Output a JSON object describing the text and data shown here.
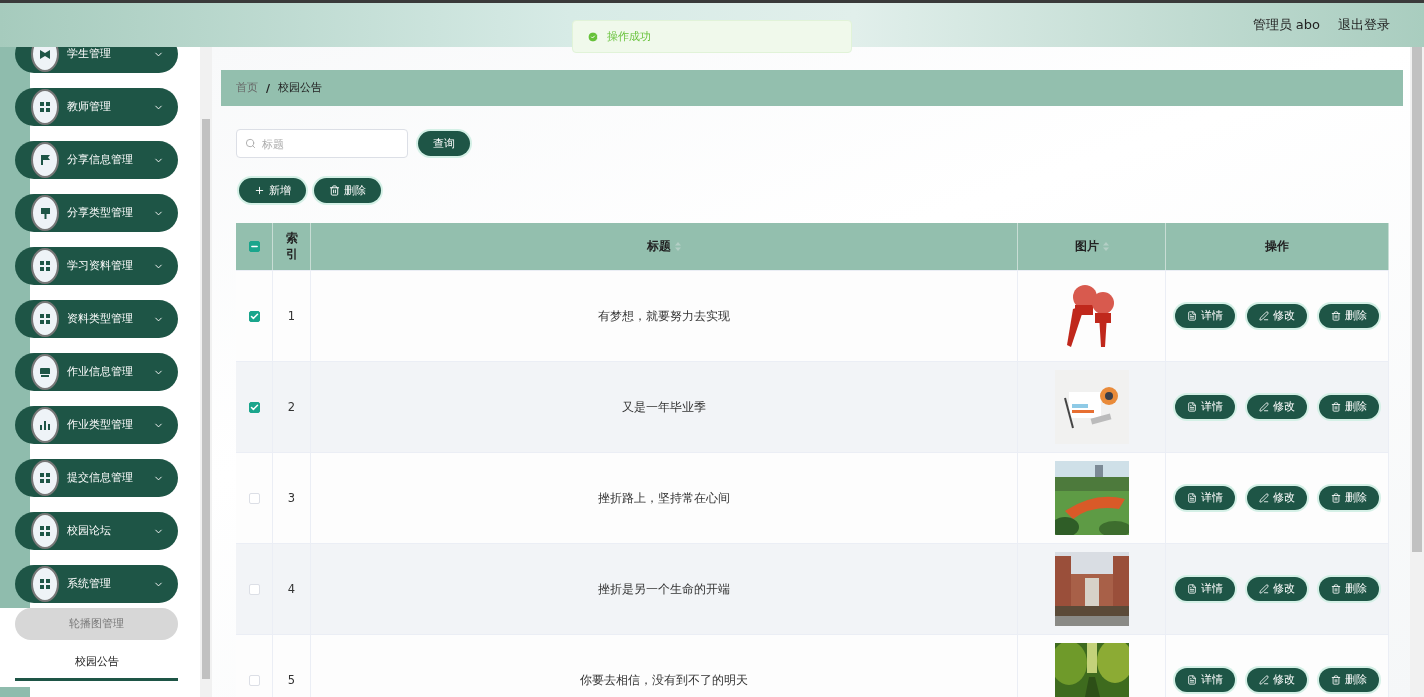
{
  "toast": {
    "message": "操作成功"
  },
  "header": {
    "user": "管理员 abo",
    "logout": "退出登录"
  },
  "sidebar": {
    "items": [
      {
        "label": "学生管理",
        "kind": "bowtie"
      },
      {
        "label": "教师管理",
        "kind": "grid"
      },
      {
        "label": "分享信息管理",
        "kind": "flag"
      },
      {
        "label": "分享类型管理",
        "kind": "pin"
      },
      {
        "label": "学习资料管理",
        "kind": "grid"
      },
      {
        "label": "资料类型管理",
        "kind": "grid"
      },
      {
        "label": "作业信息管理",
        "kind": "monitor"
      },
      {
        "label": "作业类型管理",
        "kind": "chart"
      },
      {
        "label": "提交信息管理",
        "kind": "grid"
      },
      {
        "label": "校园论坛",
        "kind": "grid"
      },
      {
        "label": "系统管理",
        "kind": "grid",
        "children": [
          {
            "label": "轮播图管理",
            "selected": false
          },
          {
            "label": "校园公告",
            "selected": true
          }
        ]
      }
    ]
  },
  "breadcrumb": [
    {
      "label": "首页",
      "selected": false
    },
    {
      "label": "校园公告",
      "selected": true
    }
  ],
  "breadcrumb_separator": "/",
  "search": {
    "placeholder": "标题",
    "button": "查询"
  },
  "toolbar": [
    {
      "label": "新增",
      "kind": "add"
    },
    {
      "label": "删除",
      "kind": "delete"
    }
  ],
  "table": {
    "select_all": {
      "indeterminate": true
    },
    "columns": [
      {
        "label": "索引",
        "sortable": false
      },
      {
        "label": "标题",
        "sortable": true
      },
      {
        "label": "图片",
        "sortable": true
      },
      {
        "label": "操作",
        "sortable": false
      }
    ],
    "rows": [
      {
        "index": "1",
        "title": "有梦想，就要努力去实现",
        "checked": true,
        "actions": [
          {
            "label": "详情",
            "kind": "detail"
          },
          {
            "label": "修改",
            "kind": "edit"
          },
          {
            "label": "删除",
            "kind": "delete"
          }
        ]
      },
      {
        "index": "2",
        "title": "又是一年毕业季",
        "checked": true,
        "actions": [
          {
            "label": "详情",
            "kind": "detail"
          },
          {
            "label": "修改",
            "kind": "edit"
          },
          {
            "label": "删除",
            "kind": "delete"
          }
        ]
      },
      {
        "index": "3",
        "title": "挫折路上，坚持常在心间",
        "checked": false,
        "actions": [
          {
            "label": "详情",
            "kind": "detail"
          },
          {
            "label": "修改",
            "kind": "edit"
          },
          {
            "label": "删除",
            "kind": "delete"
          }
        ]
      },
      {
        "index": "4",
        "title": "挫折是另一个生命的开端",
        "checked": false,
        "actions": [
          {
            "label": "详情",
            "kind": "detail"
          },
          {
            "label": "修改",
            "kind": "edit"
          },
          {
            "label": "删除",
            "kind": "delete"
          }
        ]
      },
      {
        "index": "5",
        "title": "你要去相信，没有到不了的明天",
        "checked": false,
        "actions": [
          {
            "label": "详情",
            "kind": "detail"
          },
          {
            "label": "修改",
            "kind": "edit"
          },
          {
            "label": "删除",
            "kind": "delete"
          }
        ]
      }
    ]
  }
}
